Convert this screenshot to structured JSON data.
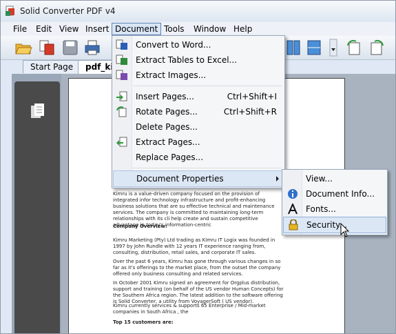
{
  "window": {
    "title": "Solid Converter PDF v4"
  },
  "menubar": [
    "File",
    "Edit",
    "View",
    "Insert",
    "Document",
    "Tools",
    "Window",
    "Help"
  ],
  "tabs": [
    "Start Page",
    "pdf_ki"
  ],
  "document_menu": {
    "items": [
      {
        "label": "Convert to Word...",
        "shortcut": "",
        "icon": "word-convert-icon"
      },
      {
        "label": "Extract Tables to Excel...",
        "shortcut": "",
        "icon": "excel-extract-icon"
      },
      {
        "label": "Extract Images...",
        "shortcut": "",
        "icon": "image-extract-icon"
      },
      {
        "label": "Insert Pages...",
        "shortcut": "Ctrl+Shift+I",
        "icon": "insert-pages-icon"
      },
      {
        "label": "Rotate Pages...",
        "shortcut": "Ctrl+Shift+R",
        "icon": "rotate-pages-icon"
      },
      {
        "label": "Delete Pages...",
        "shortcut": "",
        "icon": ""
      },
      {
        "label": "Extract Pages...",
        "shortcut": "",
        "icon": "extract-pages-icon"
      },
      {
        "label": "Replace Pages...",
        "shortcut": "",
        "icon": ""
      },
      {
        "label": "Document Properties",
        "shortcut": "",
        "icon": ""
      }
    ]
  },
  "properties_submenu": {
    "items": [
      {
        "label": "View...",
        "icon": ""
      },
      {
        "label": "Document Info...",
        "icon": "info-icon"
      },
      {
        "label": "Fonts...",
        "icon": "font-icon"
      },
      {
        "label": "Security...",
        "icon": "lock-icon"
      }
    ]
  },
  "page": {
    "para1": "Kimru is a value-driven company focused on the provision of integrated infor technology infrastructure and profit-enhancing business solutions that are su effective technical and maintenance services. The company is committed to maintaining long-term relationships with its cli help create and sustain competitive advantage in today's information-centric",
    "heading1": "Company Overview:",
    "para2": "Kimru Marketing (Pty) Ltd trading as Kimru IT Logix was founded in 1997 by John Rundle with 12 years IT experience ranging from, consulting, distribution, retail sales, and corporate IT sales.",
    "para3": "Over the past 6 years, Kimru has gone through various changes in so far as it's offerings to the market place, from the outset the company offered only business consulting and related services.",
    "para4": "In October 2001 Kimru signed an agreement for Orgplus distribution, support and training (on behalf of the US vendor Human Concepts) for the Southern Africa region. The latest addition to the software offering is Solid Converter, a utility from VoyagerSoft ( US vendor).",
    "para5": "Kimru currently services & supports 65 Enterprise / Mid-market companies in South Africa , the",
    "heading2": "Top 15 customers are:"
  },
  "colors": {
    "menu_highlight": "#dce7f5",
    "panel": "#4a4a4a"
  }
}
